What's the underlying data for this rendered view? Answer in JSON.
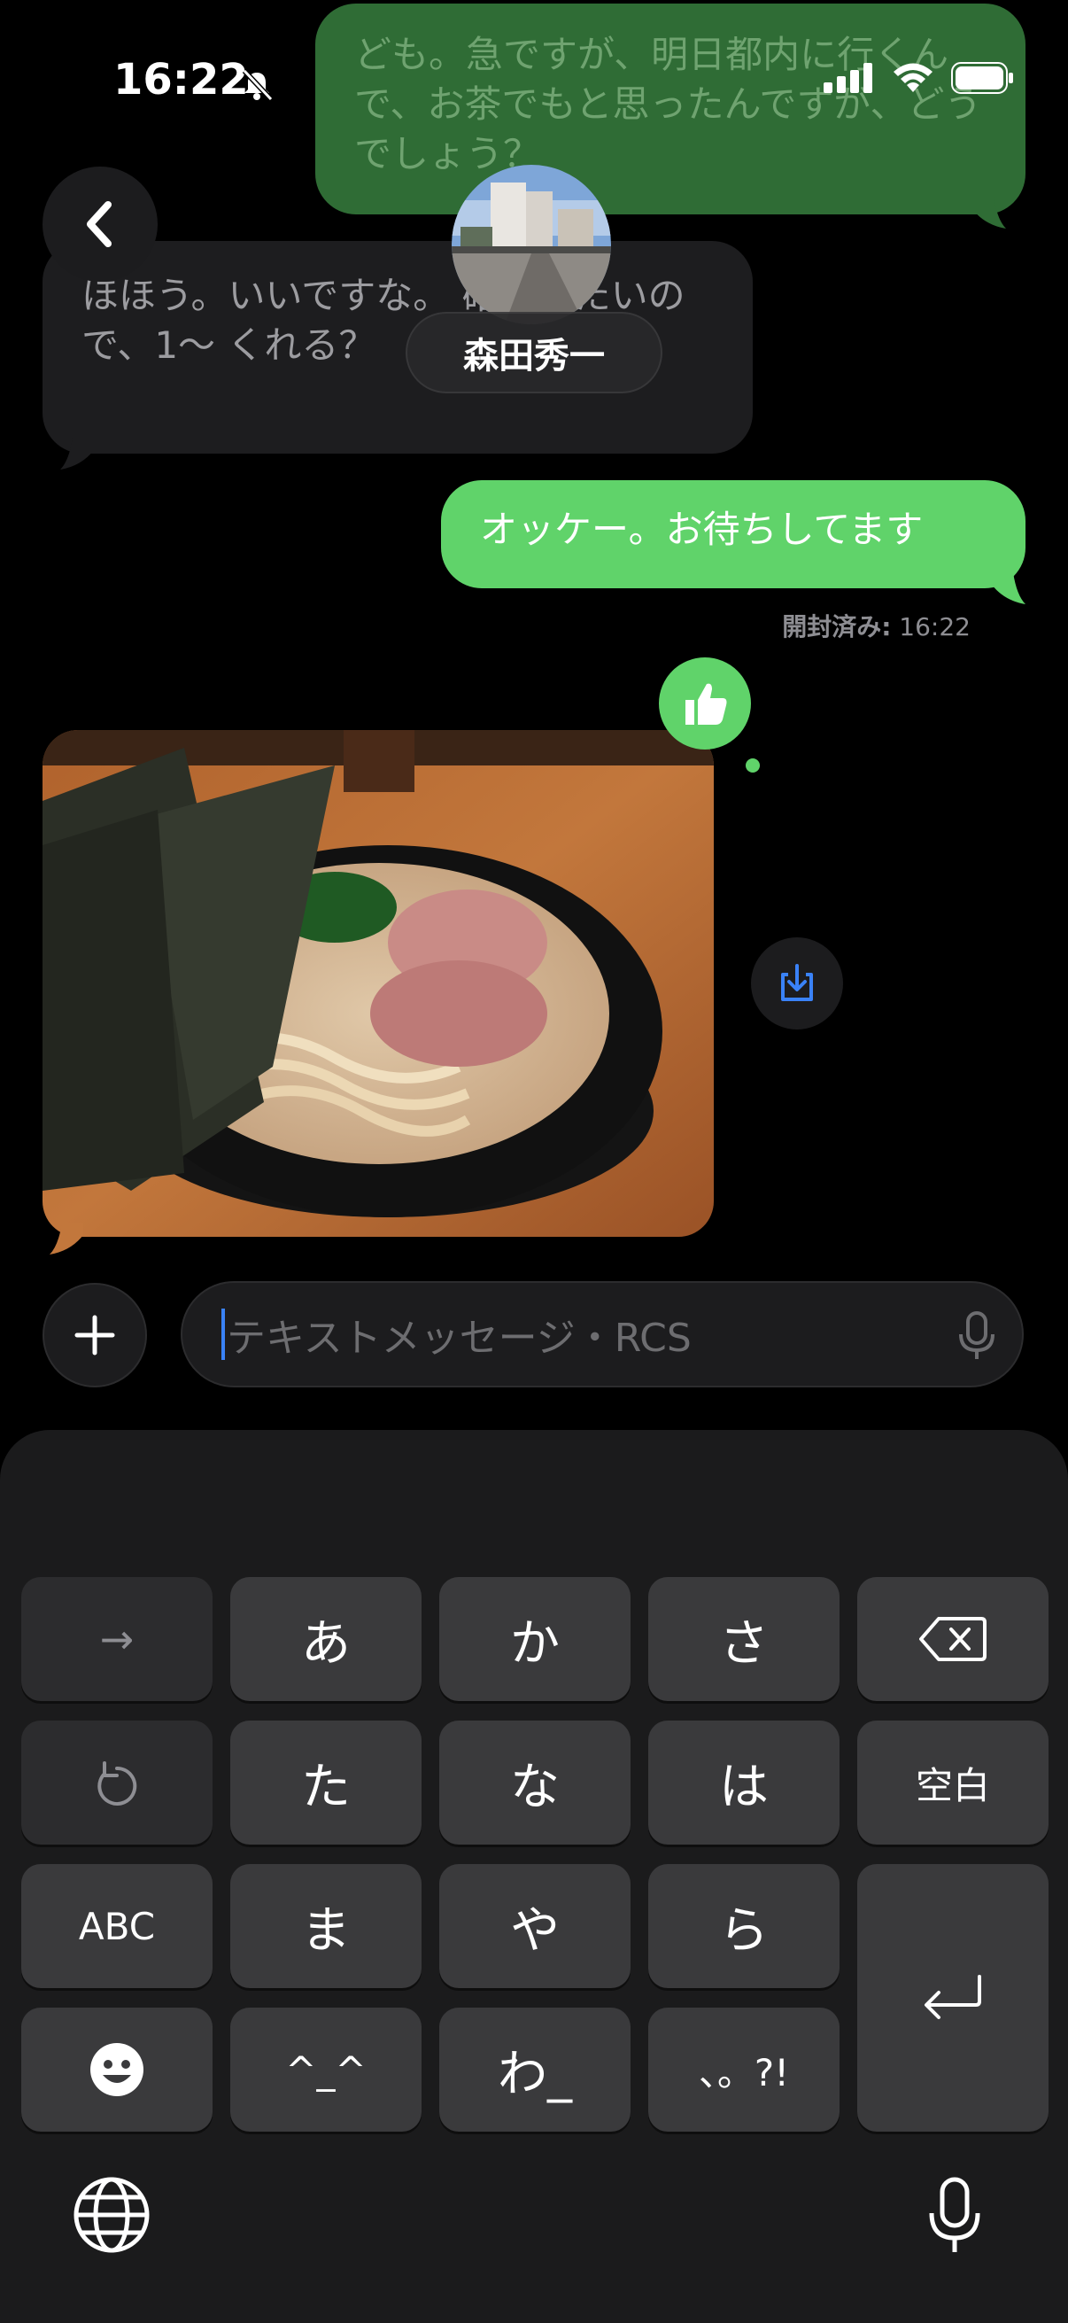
{
  "status": {
    "time": "16:22"
  },
  "header": {
    "contact_name": "森田秀一"
  },
  "messages": [
    {
      "id": "m1",
      "side": "out",
      "text": "ども。急ですが、明日都内に行くんで、お茶でもと思ったんですが、どうでしょう？"
    },
    {
      "id": "m2",
      "side": "in",
      "text": "ほほう。いいですな。 確認したいので、1〜 くれる？"
    },
    {
      "id": "m3",
      "side": "out",
      "text": "オッケー。お待ちしてます"
    }
  ],
  "read_receipt": {
    "label": "開封済み:",
    "time": "16:22"
  },
  "composer": {
    "placeholder": "テキストメッセージ・RCS"
  },
  "keyboard": {
    "rows": [
      [
        "→",
        "あ",
        "か",
        "さ",
        "⌫"
      ],
      [
        "↺",
        "た",
        "な",
        "は",
        "空白"
      ],
      [
        "ABC",
        "ま",
        "や",
        "ら",
        "⏎"
      ],
      [
        "☻",
        "^^",
        "わ_",
        "、。?!"
      ]
    ],
    "arrow": "→",
    "k_a": "あ",
    "k_ka": "か",
    "k_sa": "さ",
    "k_ta": "た",
    "k_na": "な",
    "k_ha": "は",
    "k_space": "空白",
    "k_abc": "ABC",
    "k_ma": "ま",
    "k_ya": "や",
    "k_ra": "ら",
    "k_kaomoji": "^_^",
    "k_wa": "わ_",
    "k_punct": "、。?!"
  },
  "colors": {
    "accent_green": "#60d36a",
    "caret_blue": "#3a82f7"
  }
}
